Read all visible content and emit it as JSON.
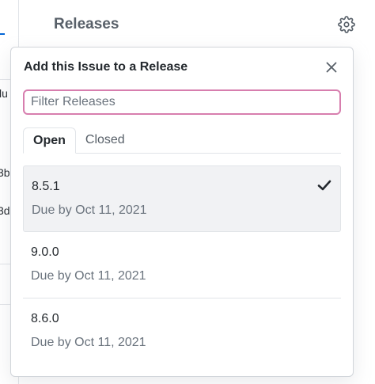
{
  "sidebar": {
    "title": "Releases",
    "settings_icon": "gear-icon"
  },
  "background_fragments": {
    "row1": "lu",
    "row2": "3b",
    "row3": "3d"
  },
  "popover": {
    "title": "Add this Issue to a Release",
    "close_icon": "close-icon",
    "filter": {
      "placeholder": "Filter Releases",
      "value": ""
    },
    "tabs": [
      {
        "label": "Open",
        "selected": true
      },
      {
        "label": "Closed",
        "selected": false
      }
    ],
    "releases": [
      {
        "name": "8.5.1",
        "due": "Due by Oct 11, 2021",
        "selected": true
      },
      {
        "name": "9.0.0",
        "due": "Due by Oct 11, 2021",
        "selected": false
      },
      {
        "name": "8.6.0",
        "due": "Due by Oct 11, 2021",
        "selected": false
      }
    ]
  },
  "colors": {
    "input_focus_border": "#d77eae",
    "selected_row_bg": "#f1f2f4",
    "muted_text": "#6a737d"
  }
}
